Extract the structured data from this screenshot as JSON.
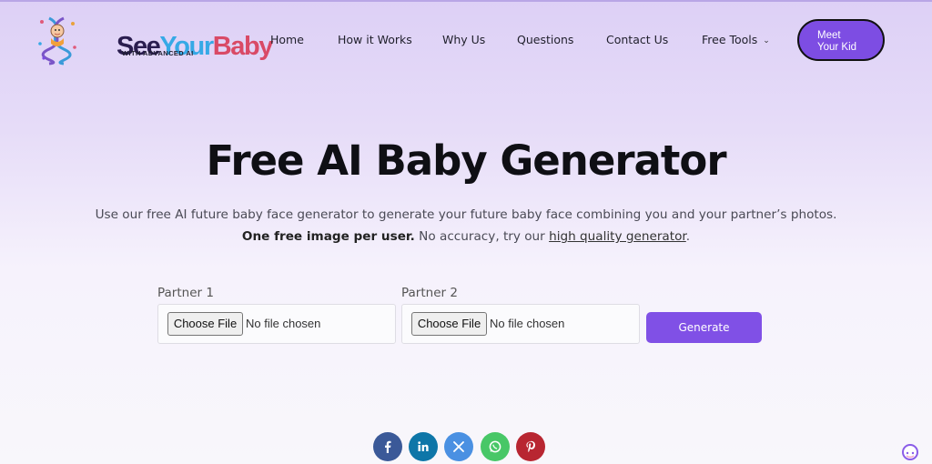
{
  "brand": {
    "name_part1": "See",
    "name_part2": "Your",
    "name_part3": "Baby",
    "tagline": "WITH ADVANCED AI"
  },
  "nav": {
    "home": "Home",
    "how_it_works": "How it Works",
    "why_us": "Why Us",
    "questions": "Questions",
    "contact_us": "Contact Us",
    "free_tools": "Free Tools",
    "cta_line1": "Meet",
    "cta_line2": "Your Kid"
  },
  "hero": {
    "title": "Free AI Baby Generator",
    "description": "Use our free AI future baby face generator to generate your future baby face combining you and your partner’s photos.",
    "note_bold": "One free image per user.",
    "note_text": " No accuracy, try our ",
    "note_link": "high quality generator",
    "note_end": "."
  },
  "form": {
    "partner1_label": "Partner 1",
    "partner2_label": "Partner 2",
    "choose_file": "Choose File",
    "no_file": "No file chosen",
    "generate": "Generate"
  },
  "share": {
    "icons": [
      "facebook-icon",
      "linkedin-icon",
      "x-icon",
      "whatsapp-icon",
      "pinterest-icon"
    ],
    "colors": {
      "facebook": "#3b5998",
      "linkedin": "#0e76a8",
      "x": "#4a90e2",
      "whatsapp": "#48c767",
      "pinterest": "#b82631"
    }
  },
  "colors": {
    "accent": "#7d4de3",
    "generate_button": "#8050e6"
  }
}
